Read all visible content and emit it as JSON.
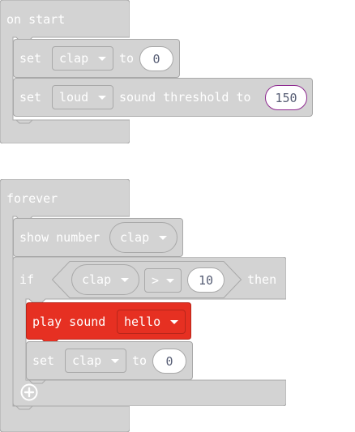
{
  "on_start": {
    "hat_label": "on start",
    "set1": {
      "set_label": "set",
      "variable": "clap",
      "to_label": "to",
      "value": "0"
    },
    "set2": {
      "set_label": "set",
      "option": "loud",
      "sound_label": "sound threshold to",
      "value": "150"
    }
  },
  "forever": {
    "hat_label": "forever",
    "show_number": {
      "label": "show number",
      "variable": "clap"
    },
    "if_block": {
      "if_label": "if",
      "left": "clap",
      "operator": ">",
      "right": "10",
      "then_label": "then",
      "play_sound": {
        "label": "play sound",
        "sound": "hello"
      },
      "set": {
        "set_label": "set",
        "variable": "clap",
        "to_label": "to",
        "value": "0"
      }
    }
  },
  "colors": {
    "disabled_block": "#d3d3d3",
    "disabled_border": "#a9a9a9",
    "play_sound_red": "#e63022",
    "number_text": "#575e75"
  },
  "icons": {
    "add": "plus-circle-icon"
  }
}
